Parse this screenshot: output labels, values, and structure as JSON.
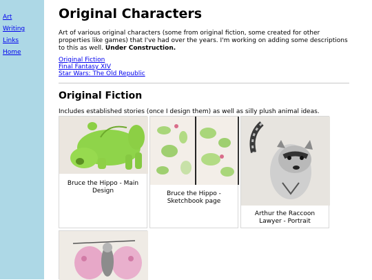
{
  "sidebar": {
    "items": [
      "Art",
      "Writing",
      "Links",
      "Home"
    ]
  },
  "page": {
    "title": "Original Characters",
    "intro": "Art of various original characters (some from original fiction, some created for other properties like games) that I've had over the years. I'm working on adding some descriptions to this as well.",
    "intro_bold": "Under Construction.",
    "links": [
      "Original Fiction",
      "Final Fantasy XIV",
      "Star Wars: The Old Republic"
    ]
  },
  "section": {
    "title": "Original Fiction",
    "description": "Includes established stories (once I design them) as well as silly plush animal ideas.",
    "cards": [
      {
        "caption": "Bruce the Hippo - Main Design"
      },
      {
        "caption": "Bruce the Hippo - Sketchbook page"
      },
      {
        "caption": "Arthur the Raccoon Lawyer - Portrait"
      }
    ]
  },
  "colors": {
    "sidebar": "#add8e6",
    "link": "#0000ee"
  }
}
